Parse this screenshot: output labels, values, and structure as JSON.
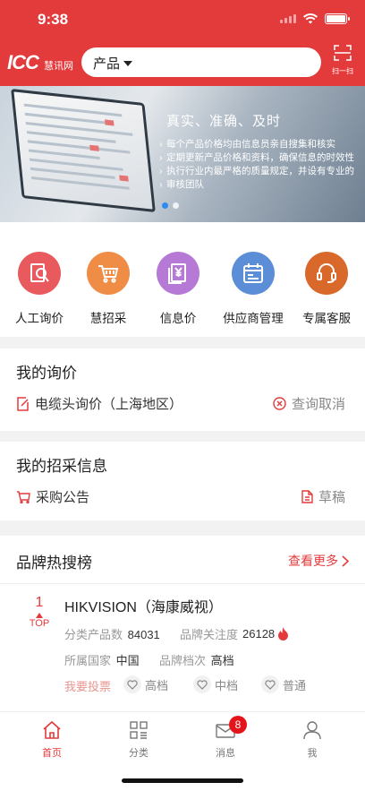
{
  "status_bar": {
    "time": "9:38"
  },
  "header": {
    "logo_text": "ICC",
    "logo_sub": "慧讯网",
    "search_category": "产品",
    "scan_label": "扫一扫"
  },
  "banner": {
    "title": "真实、准确、及时",
    "points": [
      "每个产品价格均由信息员亲自搜集和核实",
      "定期更新产品价格和资料，确保信息的时效性",
      "执行行业内最严格的质量规定，并设有专业的",
      "审核团队"
    ]
  },
  "quick_nav": [
    {
      "label": "人工询价",
      "icon": "magnifier-book-icon",
      "color": "#e85a5e"
    },
    {
      "label": "慧招采",
      "icon": "shopping-cart-icon",
      "color": "#ef8c45"
    },
    {
      "label": "信息价",
      "icon": "yen-document-icon",
      "color": "#b67ad6"
    },
    {
      "label": "供应商管理",
      "icon": "calendar-icon",
      "color": "#5b8ed6"
    },
    {
      "label": "专属客服",
      "icon": "headset-icon",
      "color": "#d9692a"
    }
  ],
  "my_inquiry": {
    "title": "我的询价",
    "item": "电缆头询价（上海地区）",
    "action": "查询取消"
  },
  "my_procurement": {
    "title": "我的招采信息",
    "item": "采购公告",
    "action": "草稿"
  },
  "brand_ranking": {
    "title": "品牌热搜榜",
    "more": "查看更多",
    "entries": [
      {
        "rank": "1",
        "rank_tag": "TOP",
        "name": "HIKVISION（海康威视）",
        "product_count_label": "分类产品数",
        "product_count": "84031",
        "attention_label": "品牌关注度",
        "attention": "26128",
        "country_label": "所属国家",
        "country": "中国",
        "grade_label": "品牌档次",
        "grade": "高档",
        "vote_label": "我要投票",
        "vote_options": [
          "高档",
          "中档",
          "普通"
        ]
      }
    ]
  },
  "tabbar": {
    "tabs": [
      {
        "label": "首页",
        "icon": "home-icon"
      },
      {
        "label": "分类",
        "icon": "category-grid-icon"
      },
      {
        "label": "消息",
        "icon": "mail-icon",
        "badge": "8"
      },
      {
        "label": "我",
        "icon": "user-icon"
      }
    ]
  },
  "colors": {
    "brand_red": "#e33a3c",
    "badge_red": "#e3141a"
  }
}
